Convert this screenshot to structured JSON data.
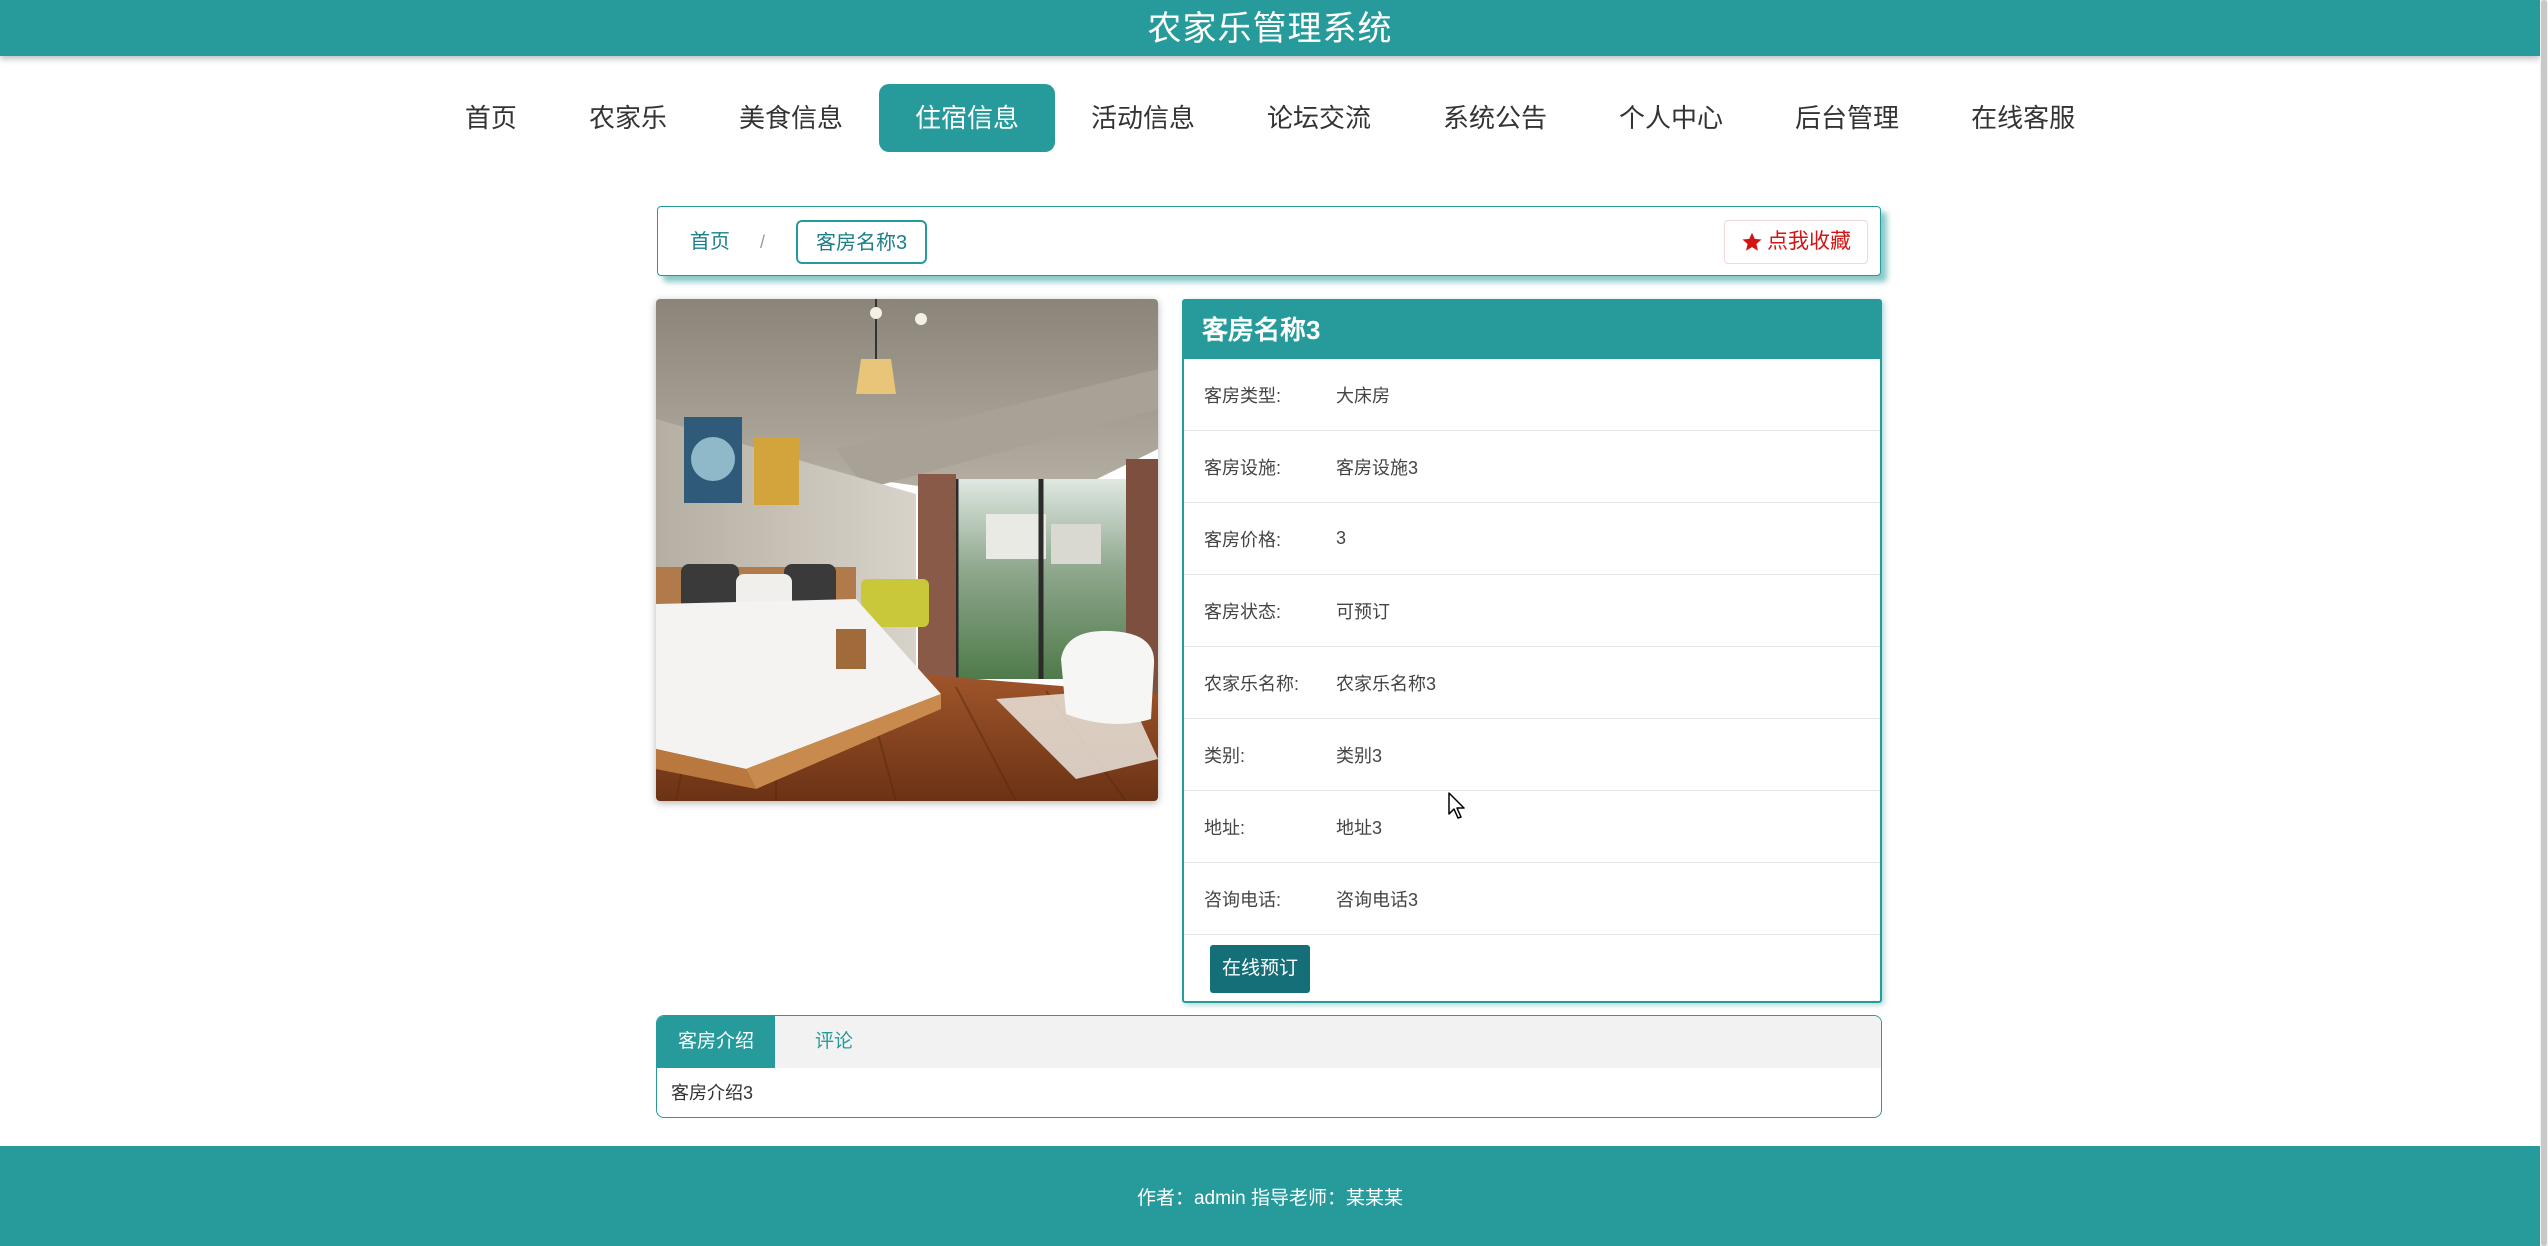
{
  "header": {
    "title": "农家乐管理系统"
  },
  "nav": {
    "items": [
      {
        "label": "首页",
        "active": false
      },
      {
        "label": "农家乐",
        "active": false
      },
      {
        "label": "美食信息",
        "active": false
      },
      {
        "label": "住宿信息",
        "active": true
      },
      {
        "label": "活动信息",
        "active": false
      },
      {
        "label": "论坛交流",
        "active": false
      },
      {
        "label": "系统公告",
        "active": false
      },
      {
        "label": "个人中心",
        "active": false
      },
      {
        "label": "后台管理",
        "active": false
      },
      {
        "label": "在线客服",
        "active": false
      }
    ]
  },
  "breadcrumb": {
    "home": "首页",
    "separator": "/",
    "current": "客房名称3",
    "favorite_label": "点我收藏"
  },
  "detail": {
    "title": "客房名称3",
    "rows": [
      {
        "label": "客房类型:",
        "value": "大床房"
      },
      {
        "label": "客房设施:",
        "value": "客房设施3"
      },
      {
        "label": "客房价格:",
        "value": "3"
      },
      {
        "label": "客房状态:",
        "value": "可预订"
      },
      {
        "label": "农家乐名称:",
        "value": "农家乐名称3"
      },
      {
        "label": "类别:",
        "value": "类别3"
      },
      {
        "label": "地址:",
        "value": "地址3"
      },
      {
        "label": "咨询电话:",
        "value": "咨询电话3"
      }
    ],
    "book_button": "在线预订"
  },
  "tabs": {
    "items": [
      {
        "label": "客房介绍",
        "active": true
      },
      {
        "label": "评论",
        "active": false
      }
    ],
    "content": "客房介绍3"
  },
  "footer": {
    "text": "作者：admin 指导老师：某某某"
  },
  "colors": {
    "primary": "#279b9b",
    "button_dark": "#146f78",
    "favorite_red": "#d41414"
  },
  "icons": {
    "favorite": "star-icon",
    "cursor": "mouse-pointer-icon"
  }
}
